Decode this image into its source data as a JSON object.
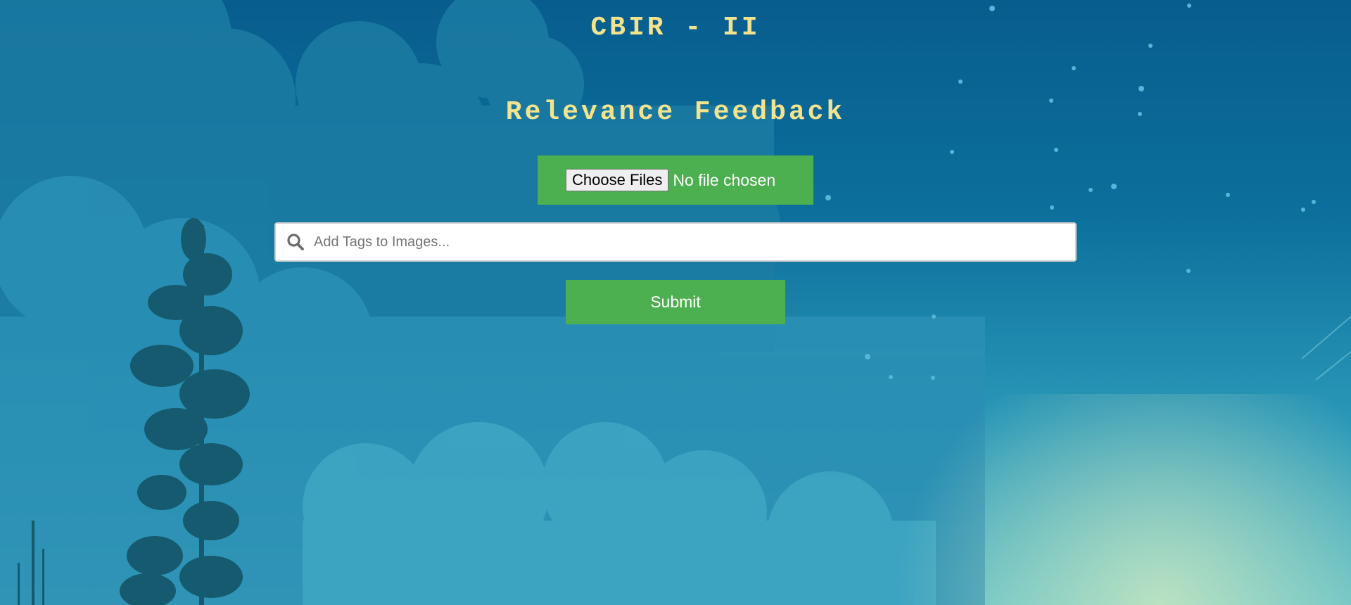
{
  "header": {
    "title": "CBIR - II",
    "subtitle": "Relevance Feedback"
  },
  "upload": {
    "button_label": "Choose Files",
    "status_text": "No file chosen"
  },
  "search": {
    "icon": "search-icon",
    "placeholder": "Add Tags to Images..."
  },
  "actions": {
    "submit_label": "Submit"
  },
  "colors": {
    "title_text": "#f3e38d",
    "accent_green": "#4caf50",
    "sky_top": "#075d8e",
    "sky_bottom": "#5fbfc8"
  }
}
